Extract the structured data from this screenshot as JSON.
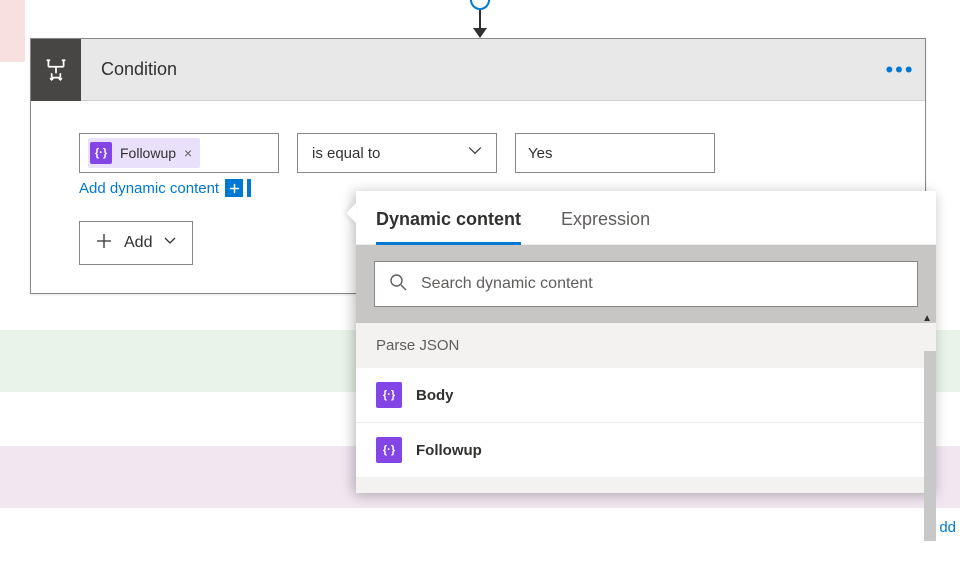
{
  "card": {
    "title": "Condition",
    "token_label": "Followup",
    "operator": "is equal to",
    "value": "Yes",
    "add_dynamic_link": "Add dynamic content",
    "add_button": "Add"
  },
  "flyout": {
    "tabs": {
      "dynamic": "Dynamic content",
      "expression": "Expression"
    },
    "search_placeholder": "Search dynamic content",
    "section_header": "Parse JSON",
    "items": [
      {
        "label": "Body"
      },
      {
        "label": "Followup"
      }
    ]
  },
  "trailing_fragment": "dd"
}
